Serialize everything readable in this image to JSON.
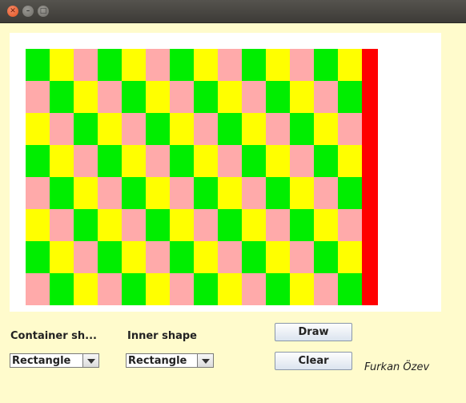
{
  "window": {
    "close_icon": "close-icon",
    "minimize_icon": "minimize-icon",
    "maximize_icon": "maximize-icon"
  },
  "board": {
    "rows": 8,
    "cols": 14,
    "colors": {
      "green": "#00ee00",
      "yellow": "#ffff00",
      "pink": "#ffaaaa",
      "red": "#ff0000"
    },
    "pattern_order": [
      "green",
      "yellow",
      "pink"
    ]
  },
  "controls": {
    "container_label": "Container sh...",
    "container_value": "Rectangle",
    "inner_label": "Inner shape",
    "inner_value": "Rectangle",
    "draw_label": "Draw",
    "clear_label": "Clear",
    "author": "Furkan Özev"
  }
}
